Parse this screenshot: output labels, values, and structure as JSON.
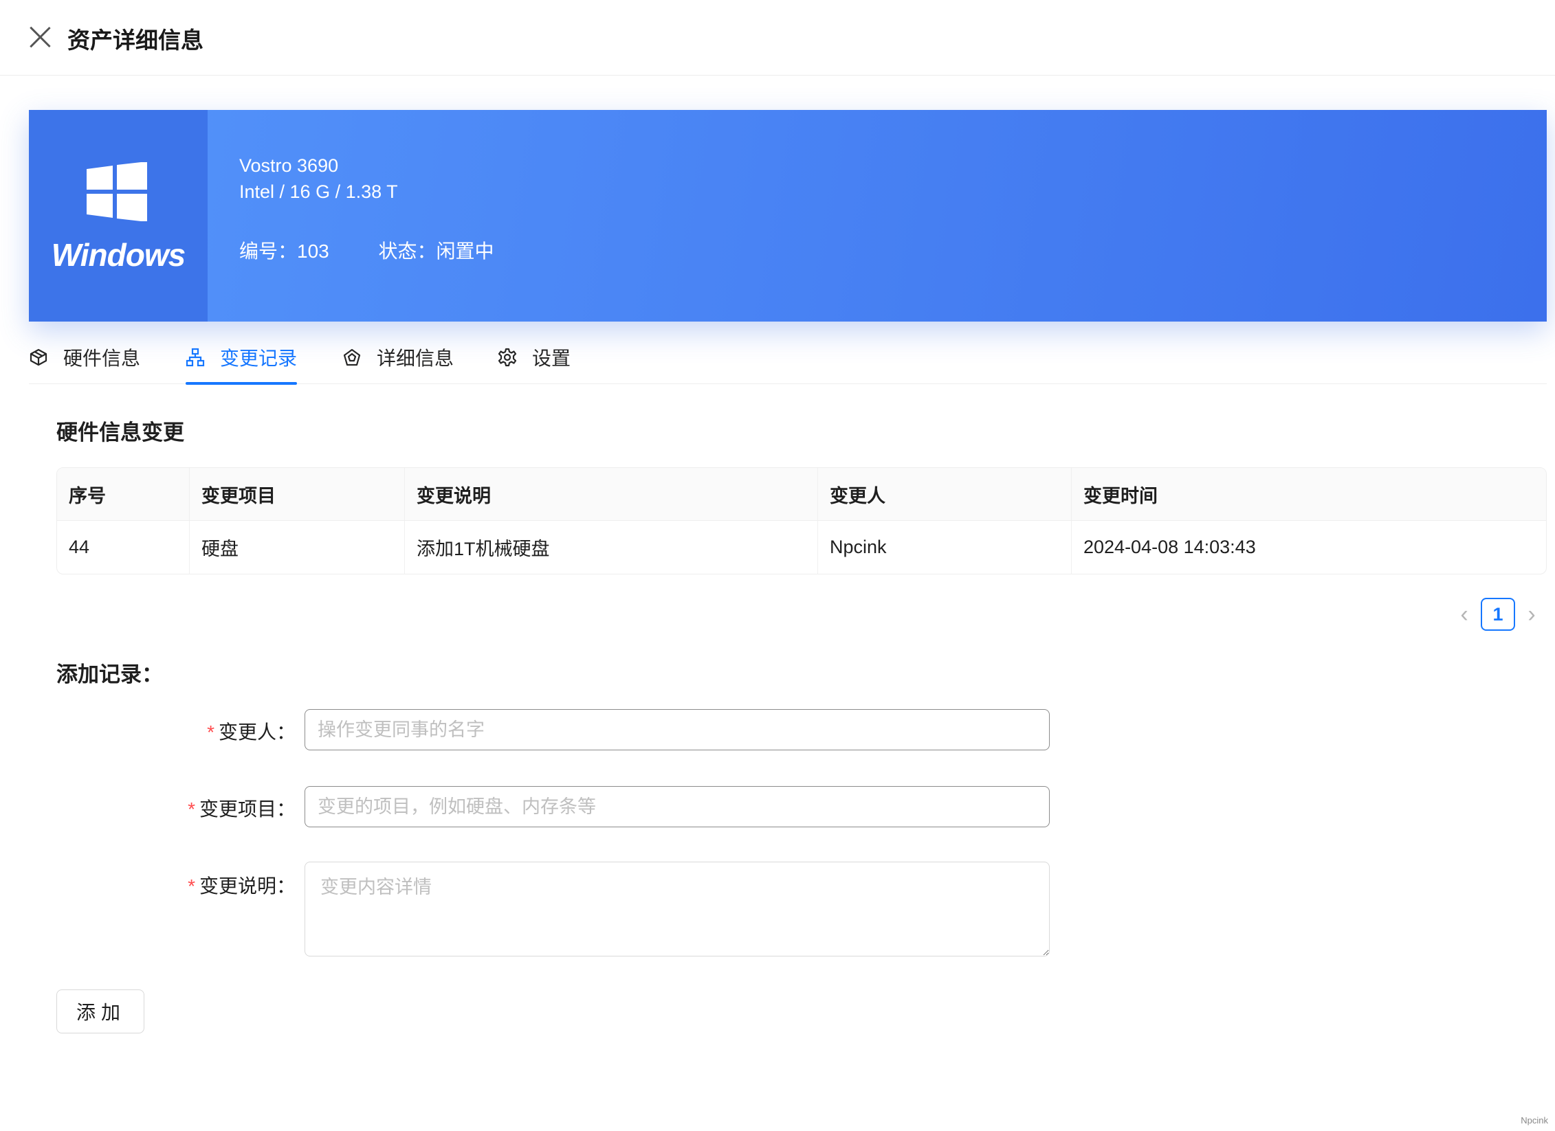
{
  "header": {
    "title": "资产详细信息"
  },
  "banner": {
    "os_name": "Windows",
    "model": "Vostro 3690",
    "specs": "Intel / 16 G / 1.38 T",
    "number_text": "编号：103",
    "status_text": "状态：闲置中",
    "colors": {
      "banner": "#4b86f5",
      "os_tile": "#3d74e9"
    }
  },
  "tabs": [
    {
      "label": "硬件信息",
      "icon": "cube-icon",
      "active": false
    },
    {
      "label": "变更记录",
      "icon": "sitemap-icon",
      "active": true
    },
    {
      "label": "详细信息",
      "icon": "gem-icon",
      "active": false
    },
    {
      "label": "设置",
      "icon": "gear-icon",
      "active": false
    }
  ],
  "changes": {
    "title": "硬件信息变更",
    "columns": [
      "序号",
      "变更项目",
      "变更说明",
      "变更人",
      "变更时间"
    ],
    "rows": [
      [
        "44",
        "硬盘",
        "添加1T机械硬盘",
        "Npcink",
        "2024-04-08 14:03:43"
      ]
    ]
  },
  "pagination": {
    "current_page": "1",
    "prev_symbol": "‹",
    "next_symbol": "›"
  },
  "form": {
    "title": "添加记录：",
    "operator_label": "变更人：",
    "operator_placeholder": "操作变更同事的名字",
    "item_label": "变更项目：",
    "item_placeholder": "变更的项目，例如硬盘、内存条等",
    "desc_label": "变更说明：",
    "desc_placeholder": "变更内容详情",
    "required_mark": "*",
    "submit_label": "添加"
  },
  "footer": {
    "watermark": "Npcink"
  },
  "colors": {
    "primary": "#1677ff",
    "required": "#ff4d4f"
  }
}
